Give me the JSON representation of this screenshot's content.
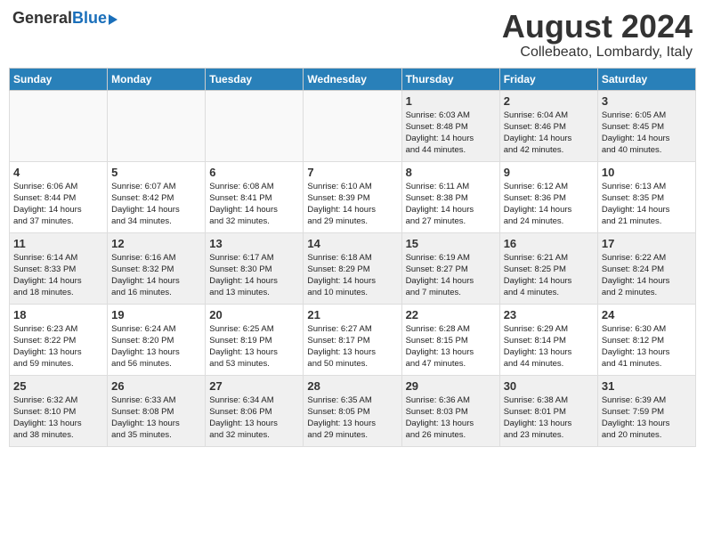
{
  "header": {
    "logo_general": "General",
    "logo_blue": "Blue",
    "month": "August 2024",
    "location": "Collebeato, Lombardy, Italy"
  },
  "days_of_week": [
    "Sunday",
    "Monday",
    "Tuesday",
    "Wednesday",
    "Thursday",
    "Friday",
    "Saturday"
  ],
  "weeks": [
    [
      {
        "num": "",
        "info": ""
      },
      {
        "num": "",
        "info": ""
      },
      {
        "num": "",
        "info": ""
      },
      {
        "num": "",
        "info": ""
      },
      {
        "num": "1",
        "info": "Sunrise: 6:03 AM\nSunset: 8:48 PM\nDaylight: 14 hours\nand 44 minutes."
      },
      {
        "num": "2",
        "info": "Sunrise: 6:04 AM\nSunset: 8:46 PM\nDaylight: 14 hours\nand 42 minutes."
      },
      {
        "num": "3",
        "info": "Sunrise: 6:05 AM\nSunset: 8:45 PM\nDaylight: 14 hours\nand 40 minutes."
      }
    ],
    [
      {
        "num": "4",
        "info": "Sunrise: 6:06 AM\nSunset: 8:44 PM\nDaylight: 14 hours\nand 37 minutes."
      },
      {
        "num": "5",
        "info": "Sunrise: 6:07 AM\nSunset: 8:42 PM\nDaylight: 14 hours\nand 34 minutes."
      },
      {
        "num": "6",
        "info": "Sunrise: 6:08 AM\nSunset: 8:41 PM\nDaylight: 14 hours\nand 32 minutes."
      },
      {
        "num": "7",
        "info": "Sunrise: 6:10 AM\nSunset: 8:39 PM\nDaylight: 14 hours\nand 29 minutes."
      },
      {
        "num": "8",
        "info": "Sunrise: 6:11 AM\nSunset: 8:38 PM\nDaylight: 14 hours\nand 27 minutes."
      },
      {
        "num": "9",
        "info": "Sunrise: 6:12 AM\nSunset: 8:36 PM\nDaylight: 14 hours\nand 24 minutes."
      },
      {
        "num": "10",
        "info": "Sunrise: 6:13 AM\nSunset: 8:35 PM\nDaylight: 14 hours\nand 21 minutes."
      }
    ],
    [
      {
        "num": "11",
        "info": "Sunrise: 6:14 AM\nSunset: 8:33 PM\nDaylight: 14 hours\nand 18 minutes."
      },
      {
        "num": "12",
        "info": "Sunrise: 6:16 AM\nSunset: 8:32 PM\nDaylight: 14 hours\nand 16 minutes."
      },
      {
        "num": "13",
        "info": "Sunrise: 6:17 AM\nSunset: 8:30 PM\nDaylight: 14 hours\nand 13 minutes."
      },
      {
        "num": "14",
        "info": "Sunrise: 6:18 AM\nSunset: 8:29 PM\nDaylight: 14 hours\nand 10 minutes."
      },
      {
        "num": "15",
        "info": "Sunrise: 6:19 AM\nSunset: 8:27 PM\nDaylight: 14 hours\nand 7 minutes."
      },
      {
        "num": "16",
        "info": "Sunrise: 6:21 AM\nSunset: 8:25 PM\nDaylight: 14 hours\nand 4 minutes."
      },
      {
        "num": "17",
        "info": "Sunrise: 6:22 AM\nSunset: 8:24 PM\nDaylight: 14 hours\nand 2 minutes."
      }
    ],
    [
      {
        "num": "18",
        "info": "Sunrise: 6:23 AM\nSunset: 8:22 PM\nDaylight: 13 hours\nand 59 minutes."
      },
      {
        "num": "19",
        "info": "Sunrise: 6:24 AM\nSunset: 8:20 PM\nDaylight: 13 hours\nand 56 minutes."
      },
      {
        "num": "20",
        "info": "Sunrise: 6:25 AM\nSunset: 8:19 PM\nDaylight: 13 hours\nand 53 minutes."
      },
      {
        "num": "21",
        "info": "Sunrise: 6:27 AM\nSunset: 8:17 PM\nDaylight: 13 hours\nand 50 minutes."
      },
      {
        "num": "22",
        "info": "Sunrise: 6:28 AM\nSunset: 8:15 PM\nDaylight: 13 hours\nand 47 minutes."
      },
      {
        "num": "23",
        "info": "Sunrise: 6:29 AM\nSunset: 8:14 PM\nDaylight: 13 hours\nand 44 minutes."
      },
      {
        "num": "24",
        "info": "Sunrise: 6:30 AM\nSunset: 8:12 PM\nDaylight: 13 hours\nand 41 minutes."
      }
    ],
    [
      {
        "num": "25",
        "info": "Sunrise: 6:32 AM\nSunset: 8:10 PM\nDaylight: 13 hours\nand 38 minutes."
      },
      {
        "num": "26",
        "info": "Sunrise: 6:33 AM\nSunset: 8:08 PM\nDaylight: 13 hours\nand 35 minutes."
      },
      {
        "num": "27",
        "info": "Sunrise: 6:34 AM\nSunset: 8:06 PM\nDaylight: 13 hours\nand 32 minutes."
      },
      {
        "num": "28",
        "info": "Sunrise: 6:35 AM\nSunset: 8:05 PM\nDaylight: 13 hours\nand 29 minutes."
      },
      {
        "num": "29",
        "info": "Sunrise: 6:36 AM\nSunset: 8:03 PM\nDaylight: 13 hours\nand 26 minutes."
      },
      {
        "num": "30",
        "info": "Sunrise: 6:38 AM\nSunset: 8:01 PM\nDaylight: 13 hours\nand 23 minutes."
      },
      {
        "num": "31",
        "info": "Sunrise: 6:39 AM\nSunset: 7:59 PM\nDaylight: 13 hours\nand 20 minutes."
      }
    ]
  ]
}
